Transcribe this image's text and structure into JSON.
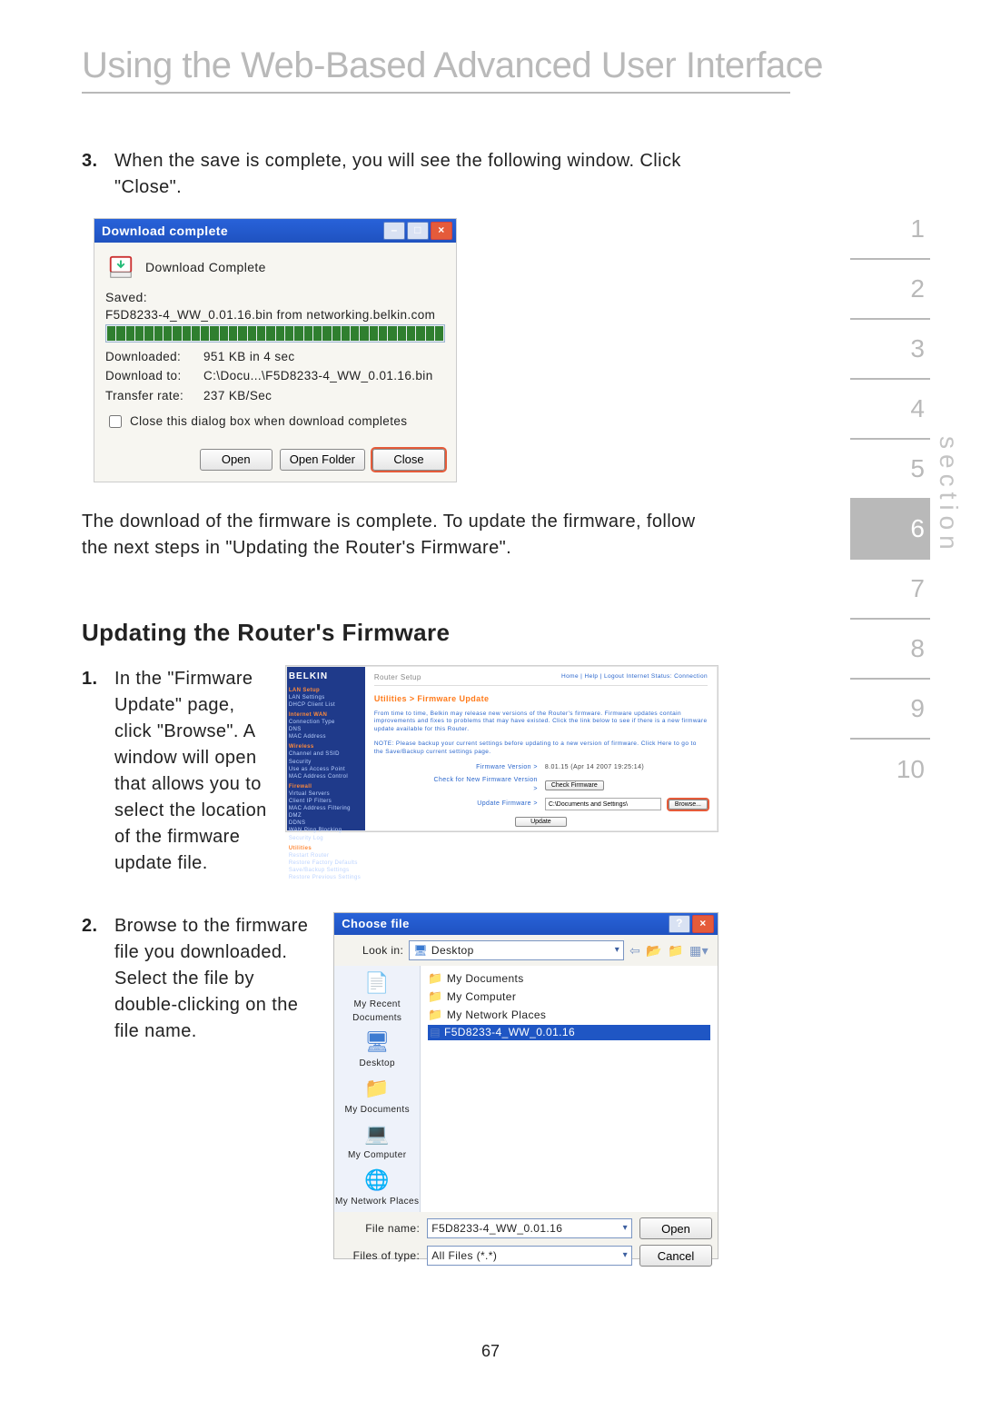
{
  "page_title": "Using the Web-Based Advanced User Interface",
  "page_number": "67",
  "section_word": "section",
  "section_nav": [
    "1",
    "2",
    "3",
    "4",
    "5",
    "6",
    "7",
    "8",
    "9",
    "10"
  ],
  "section_active_index": 5,
  "step3_num": "3.",
  "step3_text": "When the save is complete, you will see the following window. Click \"Close\".",
  "post_dlg_text": "The download of the firmware is complete. To update the firmware, follow the next steps in \"Updating the Router's Firmware\".",
  "heading2": "Updating the Router's Firmware",
  "step_fw1_num": "1.",
  "step_fw1_text": "In the \"Firmware Update\" page, click \"Browse\". A window will open that allows you to select the location of the firmware update file.",
  "step_fw2_num": "2.",
  "step_fw2_text": "Browse to the firmware file you downloaded. Select the file by double-clicking on the file name.",
  "dlg": {
    "title": "Download complete",
    "heading": "Download Complete",
    "saved_label": "Saved:",
    "saved_value": "F5D8233-4_WW_0.01.16.bin from networking.belkin.com",
    "downloaded_label": "Downloaded:",
    "downloaded_value": "951 KB in 4 sec",
    "download_to_label": "Download to:",
    "download_to_value": "C:\\Docu...\\F5D8233-4_WW_0.01.16.bin",
    "rate_label": "Transfer rate:",
    "rate_value": "237 KB/Sec",
    "checkbox": "Close this dialog box when download completes",
    "btn_open": "Open",
    "btn_open_folder": "Open Folder",
    "btn_close": "Close"
  },
  "fw": {
    "brand": "BELKIN",
    "router_setup": "Router Setup",
    "header_links": "Home | Help | Logout   Internet Status: Connection",
    "section_title": "Utilities > Firmware Update",
    "blurb1": "From time to time, Belkin may release new versions of the Router's firmware. Firmware updates contain improvements and fixes to problems that may have existed. Click the link below to see if there is a new firmware update available for this Router.",
    "blurb2": "NOTE: Please backup your current settings before updating to a new version of firmware. Click Here to go to the Save/Backup current settings page.",
    "kv1_label": "Firmware Version >",
    "kv1_value": "8.01.15 (Apr 14 2007 19:25:14)",
    "kv2_label": "Check for New Firmware Version >",
    "kv2_btn": "Check Firmware",
    "kv3_label": "Update Firmware >",
    "kv3_input": "C:\\Documents and Settings\\",
    "kv3_btn": "Browse...",
    "update_btn": "Update",
    "side_groups": [
      {
        "cat": "LAN Setup",
        "items": [
          "LAN Settings",
          "DHCP Client List"
        ]
      },
      {
        "cat": "Internet WAN",
        "items": [
          "Connection Type",
          "DNS",
          "MAC Address"
        ]
      },
      {
        "cat": "Wireless",
        "items": [
          "Channel and SSID",
          "Security",
          "Use as Access Point",
          "MAC Address Control"
        ]
      },
      {
        "cat": "Firewall",
        "items": [
          "Virtual Servers",
          "Client IP Filters",
          "MAC Address Filtering",
          "DMZ",
          "DDNS",
          "WAN Ping Blocking",
          "Security Log"
        ]
      },
      {
        "cat": "Utilities",
        "items": [
          "Restart Router",
          "Restore Factory Defaults",
          "Save/Backup Settings",
          "Restore Previous Settings"
        ]
      }
    ]
  },
  "choose": {
    "title": "Choose file",
    "lookin_label": "Look in:",
    "lookin_value": "Desktop",
    "places": [
      "My Recent Documents",
      "Desktop",
      "My Documents",
      "My Computer",
      "My Network Places"
    ],
    "files": [
      {
        "type": "folder",
        "name": "My Documents"
      },
      {
        "type": "folder",
        "name": "My Computer"
      },
      {
        "type": "folder",
        "name": "My Network Places"
      },
      {
        "type": "file",
        "name": "F5D8233-4_WW_0.01.16",
        "selected": true
      }
    ],
    "filename_label": "File name:",
    "filename_value": "F5D8233-4_WW_0.01.16",
    "filetype_label": "Files of type:",
    "filetype_value": "All Files (*.*)",
    "btn_open": "Open",
    "btn_cancel": "Cancel"
  }
}
